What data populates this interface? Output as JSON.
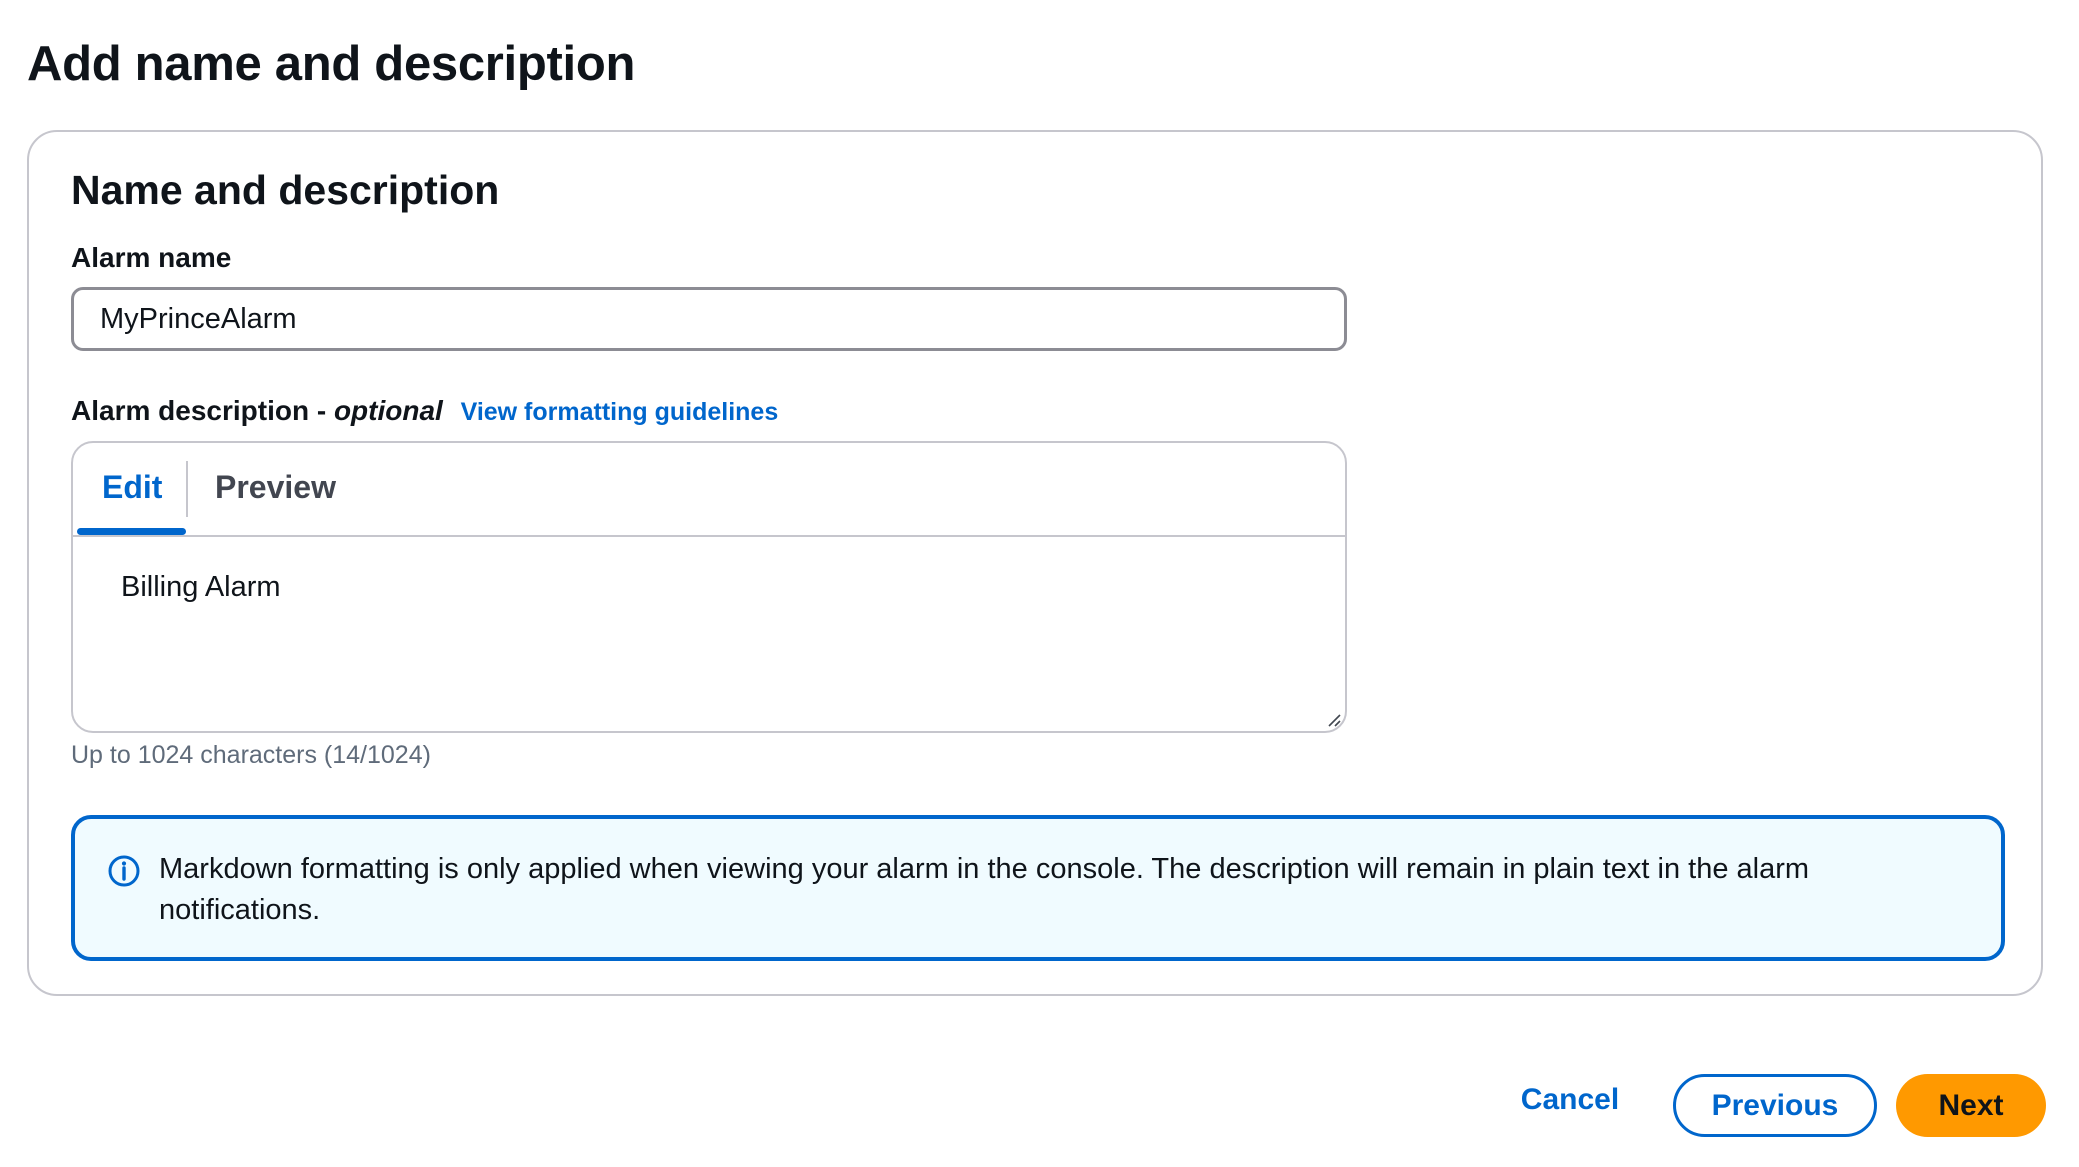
{
  "page": {
    "title": "Add name and description"
  },
  "section": {
    "title": "Name and description",
    "alarm_name": {
      "label": "Alarm name",
      "value": "MyPrinceAlarm"
    },
    "alarm_description": {
      "label": "Alarm description - ",
      "optional_label": "optional",
      "guidelines_link": "View formatting guidelines",
      "tabs": [
        {
          "label": "Edit",
          "selected": true
        },
        {
          "label": "Preview",
          "selected": false
        }
      ],
      "value": "Billing Alarm",
      "constraint": "Up to 1024 characters (14/1024)"
    },
    "info_alert": {
      "icon": "info-icon",
      "text": "Markdown formatting is only applied when viewing your alarm in the console. The description will remain in plain text in the alarm notifications."
    }
  },
  "footer": {
    "cancel_label": "Cancel",
    "previous_label": "Previous",
    "next_label": "Next"
  },
  "colors": {
    "accent": "#0066cc",
    "primary_button": "#ff9900",
    "alert_background": "#f0fbff",
    "border": "#c6c6cd"
  }
}
